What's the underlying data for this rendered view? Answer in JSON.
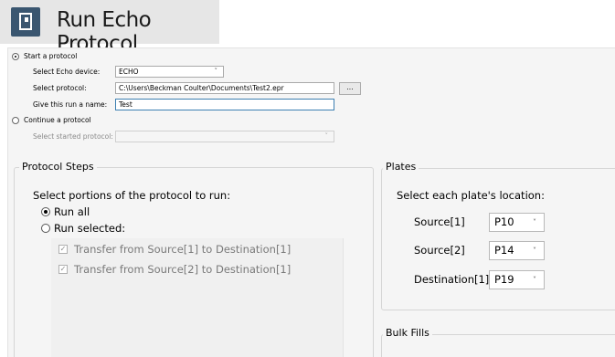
{
  "window": {
    "title": "Run Echo Protocol"
  },
  "start_section": {
    "radio_label": "Start a protocol",
    "device_label": "Select Echo device:",
    "device_value": "ECHO",
    "protocol_label": "Select protocol:",
    "protocol_value": "C:\\Users\\Beckman Coulter\\Documents\\Test2.epr",
    "browse_label": "...",
    "name_label": "Give this run a name:",
    "name_value": "Test"
  },
  "continue_section": {
    "radio_label": "Continue a protocol",
    "started_label": "Select started protocol:",
    "started_value": ""
  },
  "protocol_steps": {
    "title": "Protocol Steps",
    "instruction": "Select portions of the protocol to run:",
    "run_all_label": "Run all",
    "run_selected_label": "Run selected:",
    "steps": [
      {
        "label": "Transfer from Source[1] to Destination[1]",
        "checked": true
      },
      {
        "label": "Transfer from Source[2] to Destination[1]",
        "checked": true
      }
    ]
  },
  "plates": {
    "title": "Plates",
    "instruction": "Select each plate's location:",
    "rows": [
      {
        "label": "Source[1]",
        "value": "P10"
      },
      {
        "label": "Source[2]",
        "value": "P14"
      },
      {
        "label": "Destination[1]",
        "value": "P19"
      }
    ]
  },
  "bulk_fills": {
    "title": "Bulk Fills"
  },
  "icons": {
    "combo": "chevron-down-icon",
    "check": "checkmark-icon",
    "app": "document-icon"
  }
}
